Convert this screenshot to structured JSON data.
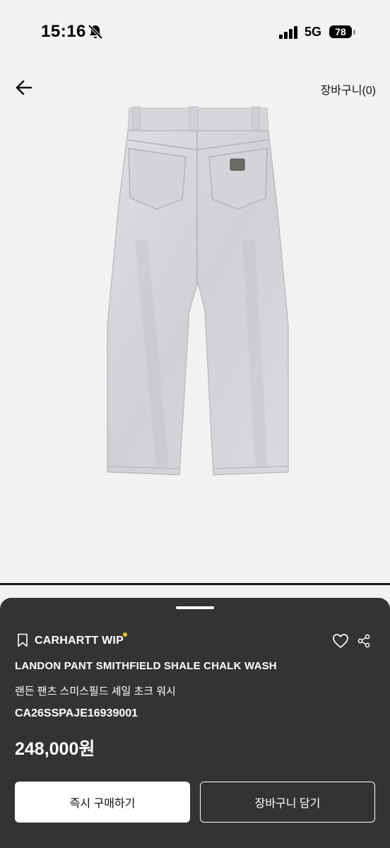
{
  "status_bar": {
    "time": "15:16",
    "network": "5G",
    "battery": "78",
    "icons": [
      "bell-off-icon",
      "signal-icon",
      "battery-icon"
    ]
  },
  "nav": {
    "back_icon": "arrow-left-icon",
    "cart_label": "장바구니(0)"
  },
  "product": {
    "image_subject": "light-wash-denim-pants-back-view",
    "brand": "CARHARTT WIP",
    "title_en": "LANDON PANT SMITHFIELD SHALE CHALK WASH",
    "title_ko": "랜든 팬츠 스미스필드 셰일 초크 워시",
    "code": "CA26SSPAJE16939001",
    "price": "248,000원"
  },
  "actions": {
    "buy_now_label": "즉시 구매하기",
    "add_to_cart_label": "장바구니 담기",
    "icons": [
      "bookmark-icon",
      "heart-icon",
      "share-icon"
    ]
  },
  "colors": {
    "page_background": "#f2f2f2",
    "sheet_background": "#333333",
    "brand_dot": "#f2c230",
    "denim": "#d6d8db"
  }
}
